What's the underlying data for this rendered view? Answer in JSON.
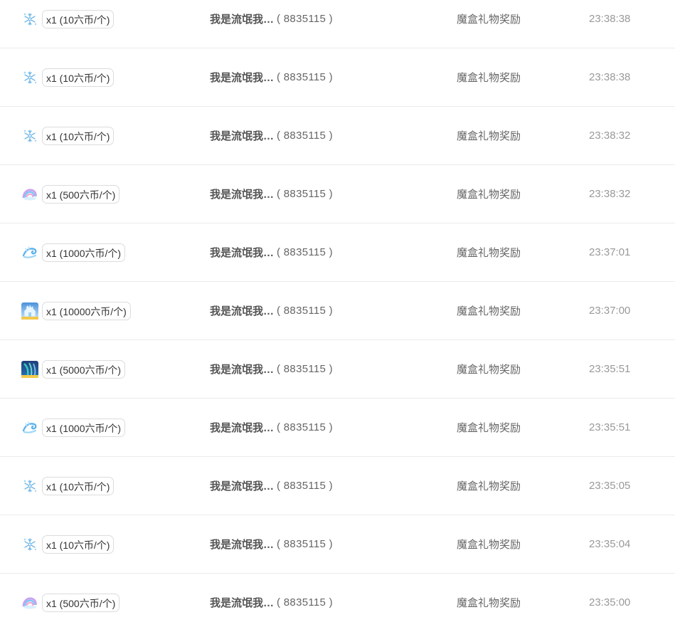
{
  "colors": {
    "badge_border": "#dcdcdc",
    "row_divider": "#ebebeb",
    "time_text": "#999999"
  },
  "records": [
    {
      "gift_icon": "snowflake-gift-icon",
      "quantity_price": "x1 (10六币/个)",
      "user_name": "我是流氓我…",
      "user_id": "( 8835115 )",
      "type": "魔盒礼物奖励",
      "time": "23:38:38"
    },
    {
      "gift_icon": "snowflake-gift-icon",
      "quantity_price": "x1 (10六币/个)",
      "user_name": "我是流氓我…",
      "user_id": "( 8835115 )",
      "type": "魔盒礼物奖励",
      "time": "23:38:38"
    },
    {
      "gift_icon": "snowflake-gift-icon",
      "quantity_price": "x1 (10六币/个)",
      "user_name": "我是流氓我…",
      "user_id": "( 8835115 )",
      "type": "魔盒礼物奖励",
      "time": "23:38:32"
    },
    {
      "gift_icon": "rainbow-wave-gift-icon",
      "quantity_price": "x1 (500六币/个)",
      "user_name": "我是流氓我…",
      "user_id": "( 8835115 )",
      "type": "魔盒礼物奖励",
      "time": "23:38:32"
    },
    {
      "gift_icon": "ice-dragon-gift-icon",
      "quantity_price": "x1 (1000六币/个)",
      "user_name": "我是流氓我…",
      "user_id": "( 8835115 )",
      "type": "魔盒礼物奖励",
      "time": "23:37:01"
    },
    {
      "gift_icon": "ice-palace-gift-icon",
      "quantity_price": "x1 (10000六币/个)",
      "user_name": "我是流氓我…",
      "user_id": "( 8835115 )",
      "type": "魔盒礼物奖励",
      "time": "23:37:00"
    },
    {
      "gift_icon": "aurora-gift-icon",
      "quantity_price": "x1 (5000六币/个)",
      "user_name": "我是流氓我…",
      "user_id": "( 8835115 )",
      "type": "魔盒礼物奖励",
      "time": "23:35:51"
    },
    {
      "gift_icon": "ice-dragon-gift-icon",
      "quantity_price": "x1 (1000六币/个)",
      "user_name": "我是流氓我…",
      "user_id": "( 8835115 )",
      "type": "魔盒礼物奖励",
      "time": "23:35:51"
    },
    {
      "gift_icon": "snowflake-gift-icon",
      "quantity_price": "x1 (10六币/个)",
      "user_name": "我是流氓我…",
      "user_id": "( 8835115 )",
      "type": "魔盒礼物奖励",
      "time": "23:35:05"
    },
    {
      "gift_icon": "snowflake-gift-icon",
      "quantity_price": "x1 (10六币/个)",
      "user_name": "我是流氓我…",
      "user_id": "( 8835115 )",
      "type": "魔盒礼物奖励",
      "time": "23:35:04"
    },
    {
      "gift_icon": "rainbow-wave-gift-icon",
      "quantity_price": "x1 (500六币/个)",
      "user_name": "我是流氓我…",
      "user_id": "( 8835115 )",
      "type": "魔盒礼物奖励",
      "time": "23:35:00"
    }
  ]
}
